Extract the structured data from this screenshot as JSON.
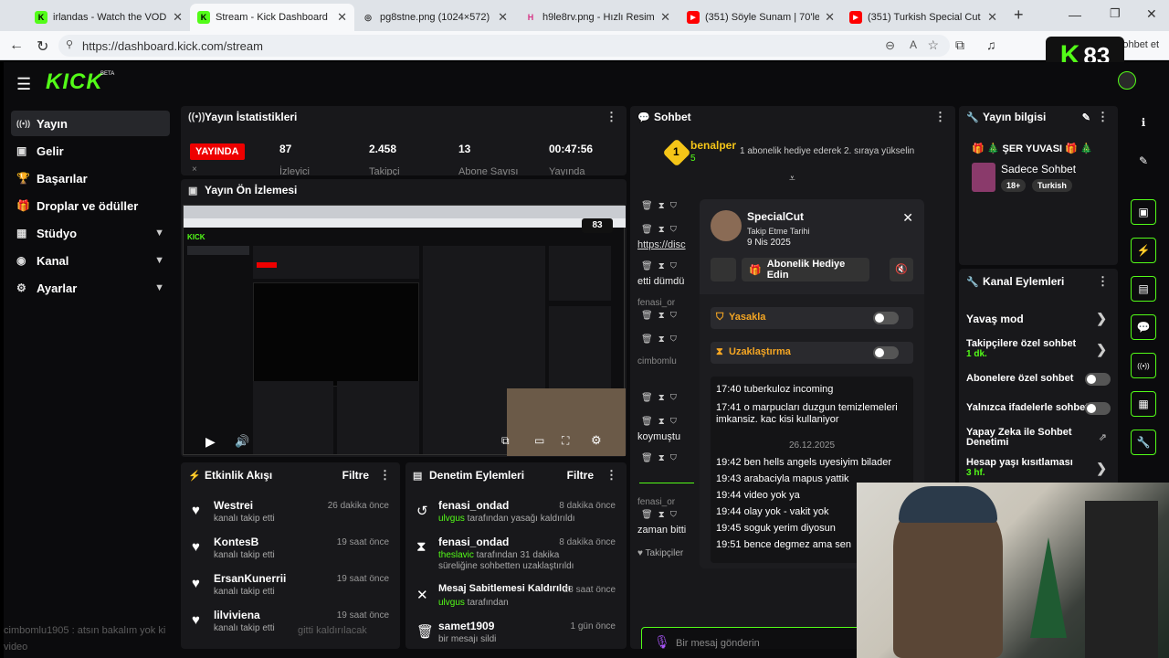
{
  "browser": {
    "tabs": [
      {
        "title": "irlandas - Watch the VOD on K",
        "color": "#53fc18",
        "fav": "K"
      },
      {
        "title": "Stream - Kick Dashboard",
        "color": "#53fc18",
        "fav": "K"
      },
      {
        "title": "pg8stne.png (1024×572)",
        "color": "#666666",
        "fav": "◎"
      },
      {
        "title": "h9le8rv.png - Hızlı Resim",
        "color": "#d63384",
        "fav": "H"
      },
      {
        "title": "(351) Söyle Sunam | 70'ler / 8",
        "color": "#ff0000",
        "fav": "▶"
      },
      {
        "title": "(351) Turkish Special Cut tara",
        "color": "#ff0000",
        "fav": "▶"
      }
    ],
    "url": "https://dashboard.kick.com/stream",
    "sohbet_text": "Sohbet et"
  },
  "overlay_logo": {
    "k": "K",
    "num": "83"
  },
  "app": {
    "logo": "KICK",
    "beta": "BETA",
    "sidebar": [
      {
        "label": "Yayın",
        "icon": "((•))"
      },
      {
        "label": "Gelir",
        "icon": "▣"
      },
      {
        "label": "Başarılar",
        "icon": "🏆"
      },
      {
        "label": "Droplar ve ödüller",
        "icon": "🎁"
      },
      {
        "label": "Stüdyo",
        "icon": "▦"
      },
      {
        "label": "Kanal",
        "icon": "◉"
      },
      {
        "label": "Ayarlar",
        "icon": "⚙"
      }
    ],
    "stats_panel": {
      "title": "Yayın İstatistikleri",
      "live_badge": "YAYINDA",
      "items": [
        {
          "value": "87",
          "label": "İzleyici"
        },
        {
          "value": "2.458",
          "label": "Takipçi"
        },
        {
          "value": "13",
          "label": "Abone Sayısı"
        },
        {
          "value": "00:47:56",
          "label": "Yayında"
        }
      ]
    },
    "preview_panel": {
      "title": "Yayın Ön İzlemesi",
      "mini_num": "83"
    },
    "activity_panel": {
      "title": "Etkinlik Akışı",
      "filter": "Filtre",
      "items": [
        {
          "name": "Westrei",
          "sub": "kanalı takip etti",
          "time": "26 dakika önce"
        },
        {
          "name": "KontesB",
          "sub": "kanalı takip etti",
          "time": "19 saat önce"
        },
        {
          "name": "ErsanKunerrii",
          "sub": "kanalı takip etti",
          "time": "19 saat önce"
        },
        {
          "name": "lilviviena",
          "sub": "kanalı takip etti",
          "time": "19 saat önce"
        }
      ]
    },
    "audit_panel": {
      "title": "Denetim Eylemleri",
      "filter": "Filtre",
      "items": [
        {
          "name": "fenasi_ondad",
          "user": "ulvgus",
          "sub": " tarafından yasağı kaldırıldı",
          "time": "8 dakika önce",
          "icon": "↺"
        },
        {
          "name": "fenasi_ondad",
          "user": "theslavic",
          "sub": " tarafından 31 dakika süreliğine sohbetten uzaklaştırıldı",
          "time": "8 dakika önce",
          "icon": "⧗"
        },
        {
          "name": "Mesaj Sabitlemesi Kaldırıldı",
          "user": "ulvgus",
          "sub": " tarafından",
          "time": "23 saat önce",
          "icon": "✕"
        },
        {
          "name": "samet1909",
          "user": "",
          "sub": "bir mesajı sildi",
          "time": "1 gün önce",
          "icon": "🗑"
        }
      ]
    },
    "chat_panel": {
      "title": "Sohbet",
      "gift_user": "benalper",
      "gift_count": "5",
      "gift_rank": "1",
      "gift_text": "1 abonelik hediye ederek 2. sıraya yükselin",
      "left_fragments": [
        "https://disc",
        "etti dümdü",
        "fenasi_or",
        "cimbomlu",
        "koymuştu",
        "fenasi_or",
        "zaman bitti",
        "Takipçiler"
      ],
      "input_placeholder": "Bir mesaj gönderin",
      "footer_count": "0",
      "footer_inf": "∞"
    },
    "user_card": {
      "name": "SpecialCut",
      "follow_label": "Takip Etme Tarihi",
      "follow_date": "9 Nis 2025",
      "gift_button": "Abonelik Hediye Edin",
      "ban_label": "Yasakla",
      "timeout_label": "Uzaklaştırma",
      "messages": [
        "17:40 tuberkuloz incoming",
        "17:41 o marpucları duzgun temizlemeleri imkansiz. kac kisi kullaniyor",
        "26.12.2025",
        "19:42 ben hells angels uyesiyim bilader",
        "19:43 arabaciyla mapus yattik",
        "19:44 video yok ya",
        "19:44 olay yok - vakit yok",
        "19:45 soguk yerim diyosun",
        "19:51 bence degmez ama sen"
      ]
    },
    "stream_info": {
      "title": "Yayın bilgisi",
      "stream_title": "🎁 🎄 ŞER YUVASI 🎁 🎄",
      "category": "Sadece Sohbet",
      "tags": [
        "18+",
        "Turkish"
      ]
    },
    "channel_actions": {
      "title": "Kanal Eylemleri",
      "items": [
        {
          "label": "Yavaş mod",
          "sub": ""
        },
        {
          "label": "Takipçilere özel sohbet",
          "sub": "1 dk."
        },
        {
          "label": "Abonelere özel sohbet",
          "sub": ""
        },
        {
          "label": "Yalnızca ifadelerle sohbet",
          "sub": ""
        },
        {
          "label": "Yapay Zeka ile Sohbet Denetimi",
          "sub": ""
        },
        {
          "label": "Hesap yaşı kısıtlaması",
          "sub": "3 hf."
        }
      ]
    },
    "bottom_overlay": {
      "line1": "cimbomlu1905 : atsın bakalım yok ki",
      "line2": "gitti kaldırılacak",
      "line3": "video"
    }
  }
}
